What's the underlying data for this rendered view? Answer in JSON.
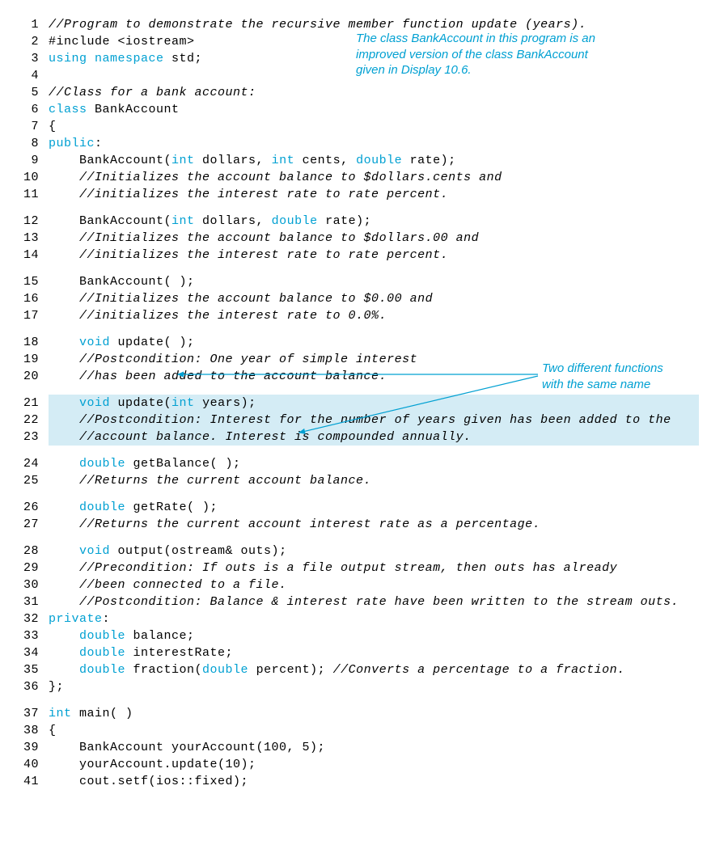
{
  "annotations": {
    "a1_l1": "The class BankAccount in this program is an",
    "a1_l2": "improved version of the class BankAccount",
    "a1_l3": "given in Display 10.6.",
    "a2_l1": "Two different functions",
    "a2_l2": "with the same name"
  },
  "lines": {
    "l1": "//Program to demonstrate the recursive member function update (years).",
    "l2a": "#include <iostream>",
    "l3a": "using namespace",
    "l3b": " std;",
    "l5": "//Class for a bank account:",
    "l6a": "class",
    "l6b": " BankAccount",
    "l7": "{",
    "l8a": "public",
    "l8b": ":",
    "l9a": "    BankAccount(",
    "l9b": "int",
    "l9c": " dollars, ",
    "l9d": "int",
    "l9e": " cents, ",
    "l9f": "double",
    "l9g": " rate);",
    "l10": "    //Initializes the account balance to $dollars.cents and",
    "l11": "    //initializes the interest rate to rate percent.",
    "l12a": "    BankAccount(",
    "l12b": "int",
    "l12c": " dollars, ",
    "l12d": "double",
    "l12e": " rate);",
    "l13": "    //Initializes the account balance to $dollars.00 and",
    "l14": "    //initializes the interest rate to rate percent.",
    "l15": "    BankAccount( );",
    "l16": "    //Initializes the account balance to $0.00 and",
    "l17": "    //initializes the interest rate to 0.0%.",
    "l18a": "    ",
    "l18b": "void",
    "l18c": " update( );",
    "l19": "    //Postcondition: One year of simple interest",
    "l20": "    //has been added to the account balance.",
    "l21a": "    ",
    "l21b": "void",
    "l21c": " update(",
    "l21d": "int",
    "l21e": " years);",
    "l22": "    //Postcondition: Interest for the number of years given has been added to the",
    "l23": "    //account balance. Interest is compounded annually.",
    "l24a": "    ",
    "l24b": "double",
    "l24c": " getBalance( );",
    "l25": "    //Returns the current account balance.",
    "l26a": "    ",
    "l26b": "double",
    "l26c": " getRate( );",
    "l27": "    //Returns the current account interest rate as a percentage.",
    "l28a": "    ",
    "l28b": "void",
    "l28c": " output(ostream& outs);",
    "l29": "    //Precondition: If outs is a file output stream, then outs has already",
    "l30": "    //been connected to a file.",
    "l31": "    //Postcondition: Balance & interest rate have been written to the stream outs.",
    "l32a": "private",
    "l32b": ":",
    "l33a": "    ",
    "l33b": "double",
    "l33c": " balance;",
    "l34a": "    ",
    "l34b": "double",
    "l34c": " interestRate;",
    "l35a": "    ",
    "l35b": "double",
    "l35c": " fraction(",
    "l35d": "double",
    "l35e": " percent); ",
    "l35f": "//Converts a percentage to a fraction.",
    "l36": "};",
    "l37a": "int",
    "l37b": " main( )",
    "l38": "{",
    "l39": "    BankAccount yourAccount(100, 5);",
    "l40": "    yourAccount.update(10);",
    "l41": "    cout.setf(ios::fixed);"
  },
  "nums": {
    "n1": "1",
    "n2": "2",
    "n3": "3",
    "n4": "4",
    "n5": "5",
    "n6": "6",
    "n7": "7",
    "n8": "8",
    "n9": "9",
    "n10": "10",
    "n11": "11",
    "n12": "12",
    "n13": "13",
    "n14": "14",
    "n15": "15",
    "n16": "16",
    "n17": "17",
    "n18": "18",
    "n19": "19",
    "n20": "20",
    "n21": "21",
    "n22": "22",
    "n23": "23",
    "n24": "24",
    "n25": "25",
    "n26": "26",
    "n27": "27",
    "n28": "28",
    "n29": "29",
    "n30": "30",
    "n31": "31",
    "n32": "32",
    "n33": "33",
    "n34": "34",
    "n35": "35",
    "n36": "36",
    "n37": "37",
    "n38": "38",
    "n39": "39",
    "n40": "40",
    "n41": "41"
  }
}
